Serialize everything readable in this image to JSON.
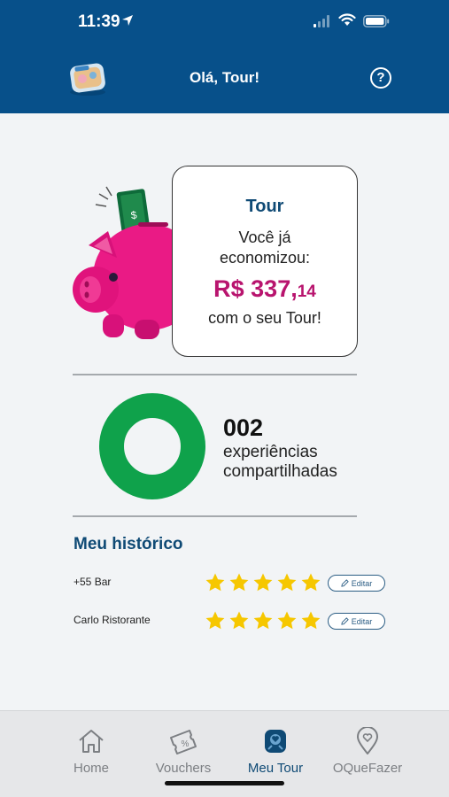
{
  "status_bar": {
    "time": "11:39"
  },
  "header": {
    "title": "Olá, Tour!",
    "help_label": "?"
  },
  "savings": {
    "card_title": "Tour",
    "line1": "Você já",
    "line2": "economizou:",
    "amount_main": "R$ 337,",
    "amount_cents": "14",
    "footer": "com o seu Tour!",
    "bill_symbol": "$"
  },
  "experiences": {
    "count": "002",
    "label_line1": "experiências",
    "label_line2": "compartilhadas"
  },
  "history": {
    "title": "Meu histórico",
    "items": [
      {
        "name": "+55 Bar",
        "rating": 5,
        "edit_label": "Editar"
      },
      {
        "name": "Carlo Ristorante",
        "rating": 5,
        "edit_label": "Editar"
      }
    ]
  },
  "tabs": [
    {
      "label": "Home",
      "icon": "home-icon",
      "active": false
    },
    {
      "label": "Vouchers",
      "icon": "voucher-icon",
      "active": false
    },
    {
      "label": "Meu Tour",
      "icon": "meu-tour-icon",
      "active": true
    },
    {
      "label": "OQueFazer",
      "icon": "location-icon",
      "active": false
    }
  ],
  "colors": {
    "header": "#07508a",
    "title_blue": "#0f4a75",
    "amount_magenta": "#b8146e",
    "pig_pink": "#ea1a85",
    "ring_green": "#0fa24b",
    "star_yellow": "#f6c700"
  }
}
